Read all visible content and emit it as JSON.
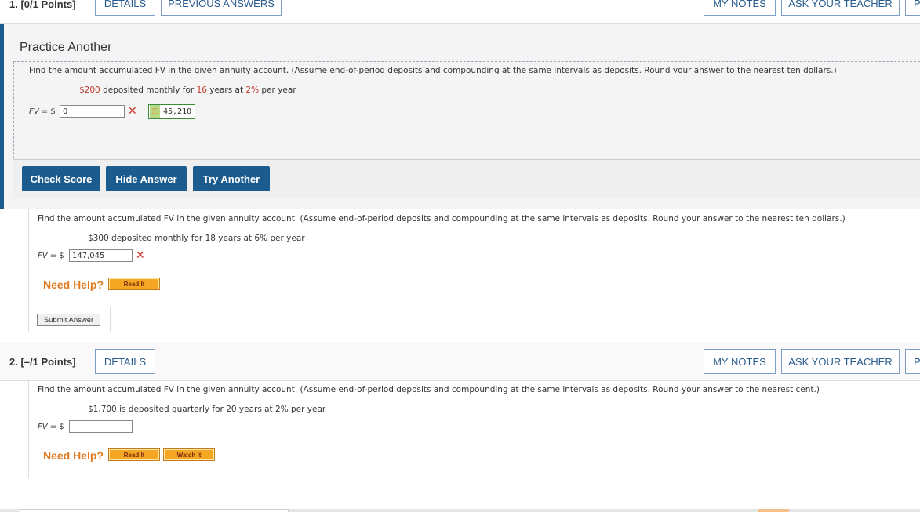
{
  "q1": {
    "label": "1. [0/1 Points]",
    "details": "DETAILS",
    "previous_answers": "PREVIOUS ANSWERS",
    "my_notes": "MY NOTES",
    "ask_teacher": "ASK YOUR TEACHER",
    "practice": {
      "title": "Practice Another",
      "prompt": "Find the amount accumulated FV in the given annuity account. (Assume end-of-period deposits and compounding at the same intervals as deposits. Round your answer to the nearest ten dollars.)",
      "given_p1": "$200",
      "given_p2": " deposited monthly for ",
      "given_p3": "16",
      "given_p4": " years at ",
      "given_p5": "2%",
      "given_p6": " per year",
      "fv_label": "FV",
      "fv_eq": " = $",
      "input_value": "0",
      "correct_answer": "45,210",
      "buttons": [
        "Check Score",
        "Hide Answer",
        "Try Another"
      ]
    },
    "original": {
      "prompt": "Find the amount accumulated FV in the given annuity account. (Assume end-of-period deposits and compounding at the same intervals as deposits. Round your answer to the nearest ten dollars.)",
      "given": "$300 deposited monthly for 18 years at 6% per year",
      "fv_label": "FV",
      "fv_eq": " = $",
      "input_value": "147,045",
      "need_help": "Need Help?",
      "read_it": "Read It",
      "submit": "Submit Answer"
    }
  },
  "q2": {
    "label": "2. [–/1 Points]",
    "details": "DETAILS",
    "my_notes": "MY NOTES",
    "ask_teacher": "ASK YOUR TEACHER",
    "prompt": "Find the amount accumulated FV in the given annuity account. (Assume end-of-period deposits and compounding at the same intervals as deposits. Round your answer to the nearest cent.)",
    "given": "$1,700 is deposited quarterly for 20 years at 2% per year",
    "fv_label": "FV",
    "fv_eq": " = $",
    "input_value": "",
    "need_help": "Need Help?",
    "read_it": "Read It",
    "watch_it": "Watch It"
  },
  "colors": {
    "accent_blue": "#1c5b8e",
    "link_blue": "#2a5c8f",
    "incorrect_red": "#d0342c",
    "need_help_orange": "#e07b1f",
    "correct_green": "#3a8a3a"
  }
}
